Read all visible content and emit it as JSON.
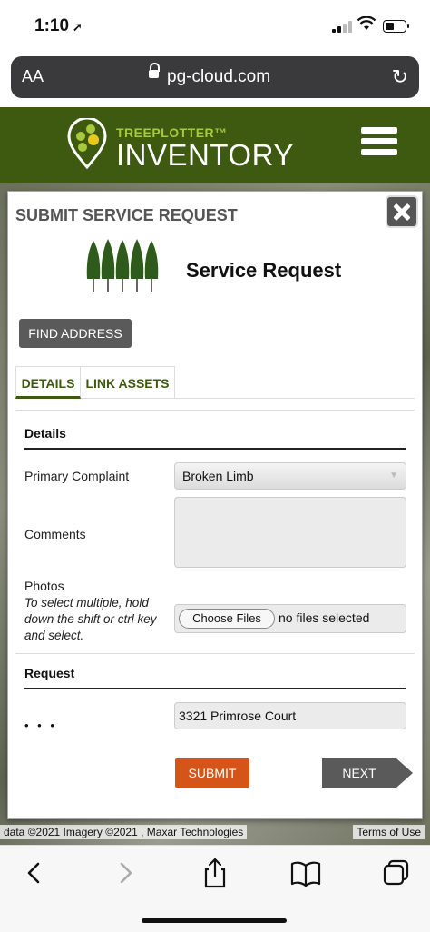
{
  "status_bar": {
    "time": "1:10",
    "location_glyph": "➚"
  },
  "browser": {
    "aa": "AA",
    "url": "pg-cloud.com",
    "reload_glyph": "↻"
  },
  "brand": {
    "top_line": "TREEPLOTTER™",
    "bottom_line": "INVENTORY",
    "colors": {
      "header": "#3e5a10",
      "accent": "#a8c93a"
    }
  },
  "modal": {
    "title": "SUBMIT SERVICE REQUEST",
    "hero_title": "Service Request",
    "find_address": "FIND ADDRESS",
    "tabs": [
      {
        "label": "DETAILS"
      },
      {
        "label": "LINK ASSETS"
      }
    ],
    "details_section": "Details",
    "fields": {
      "primary_complaint": {
        "label": "Primary Complaint",
        "value": "Broken Limb"
      },
      "comments": {
        "label": "Comments",
        "value": ""
      },
      "photos": {
        "label": "Photos",
        "hint": "To select multiple, hold down the shift or ctrl key and select.",
        "button": "Choose Files",
        "status": "no files selected"
      }
    },
    "request_section": "Request",
    "request_dots": "• • •",
    "address_value": "3321 Primrose Court",
    "submit": "SUBMIT",
    "next": "NEXT",
    "colors": {
      "submit": "#d4541a",
      "next": "#5a5a5a"
    }
  },
  "map": {
    "attribution": "data ©2021 Imagery ©2021 , Maxar Technologies",
    "terms": "Terms of Use"
  },
  "toolbar": [
    "back-icon",
    "forward-icon",
    "share-icon",
    "bookmarks-icon",
    "tabs-icon"
  ]
}
